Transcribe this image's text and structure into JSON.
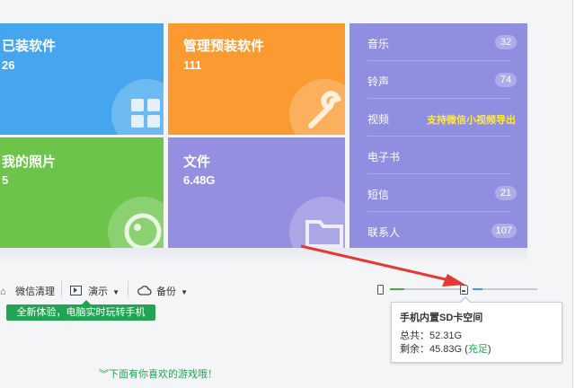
{
  "tiles": {
    "installed": {
      "title": "已装软件",
      "value": "26"
    },
    "preinstalled": {
      "title": "管理预装软件",
      "value": "111"
    },
    "photos": {
      "title": "我的照片",
      "value": "5"
    },
    "files": {
      "title": "文件",
      "value": "6.48G"
    }
  },
  "side_panel": {
    "items": [
      {
        "label": "音乐",
        "count": "32"
      },
      {
        "label": "铃声",
        "count": "74"
      },
      {
        "label": "视频",
        "promo": "支持微信小视频导出"
      },
      {
        "label": "电子书"
      },
      {
        "label": "短信",
        "count": "21"
      },
      {
        "label": "联系人",
        "count": "107"
      }
    ]
  },
  "toolbar": {
    "wechat_cleanup": "微信清理",
    "demo": "演示",
    "backup": "备份"
  },
  "demo_tip": "全新体验，电脑实时玩转手机",
  "storage": {
    "phone_used_fraction": 0.2,
    "sd_used_fraction": 0.15
  },
  "tooltip": {
    "title": "手机内置SD卡空间",
    "total_label": "总共：",
    "total_value": "52.31G",
    "free_label": "剩余：",
    "free_value": "45.83G",
    "status_open": "(",
    "status": "充足",
    "status_close": ")"
  },
  "games_link": "下面有你喜欢的游戏哦！",
  "colors": {
    "blue": "#45a6ef",
    "orange": "#fa9a30",
    "green": "#6cc44a",
    "purple": "#948fe0",
    "accent_green": "#23a455",
    "promo_yellow": "#ffe84a",
    "arrow_red": "#e53935"
  }
}
